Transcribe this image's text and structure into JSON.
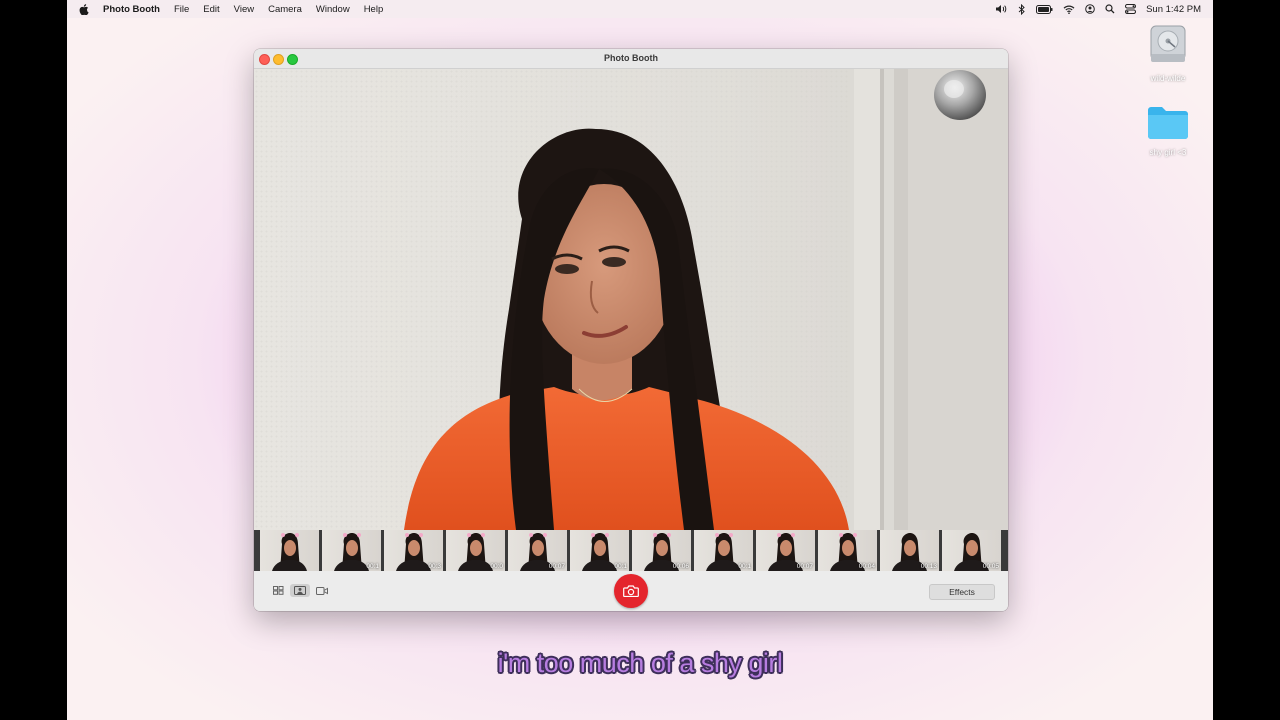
{
  "menubar": {
    "app_name": "Photo Booth",
    "items": [
      "File",
      "Edit",
      "View",
      "Camera",
      "Window",
      "Help"
    ],
    "clock": "Sun 1:42 PM"
  },
  "desktop": {
    "icons": [
      {
        "label": "wild-wilde",
        "icon": "hard-drive-icon"
      },
      {
        "label": "shy girl <3",
        "icon": "folder-icon"
      }
    ]
  },
  "window": {
    "title": "Photo Booth",
    "effects_label": "Effects"
  },
  "filmstrip": {
    "durations": [
      "",
      "00:1",
      "00:3",
      "00:0",
      "00:07",
      "00:1",
      "00:06",
      "00:1",
      "00:07",
      "00:04",
      "00:13",
      "00:05"
    ]
  },
  "caption": "i'm too much of a shy girl",
  "colors": {
    "shutter": "#e4252d",
    "caption_fill": "#b77de0",
    "caption_outline": "#3e2f5a"
  }
}
